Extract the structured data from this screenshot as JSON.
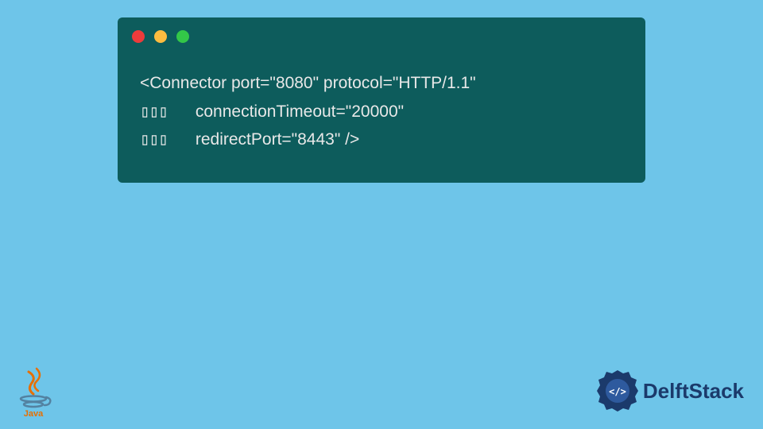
{
  "code": {
    "line1": "<Connector port=\"8080\" protocol=\"HTTP/1.1\"",
    "line2_indent": "▯▯▯   ",
    "line2": "connectionTimeout=\"20000\"",
    "line3_indent": "▯▯▯   ",
    "line3": "redirectPort=\"8443\" />"
  },
  "branding": {
    "java_label": "Java",
    "delft_label": "DelftStack"
  },
  "colors": {
    "background": "#6ec5e9",
    "code_bg": "#0d5c5c",
    "code_fg": "#e8e8e8",
    "delft_blue": "#1b3a6b"
  }
}
